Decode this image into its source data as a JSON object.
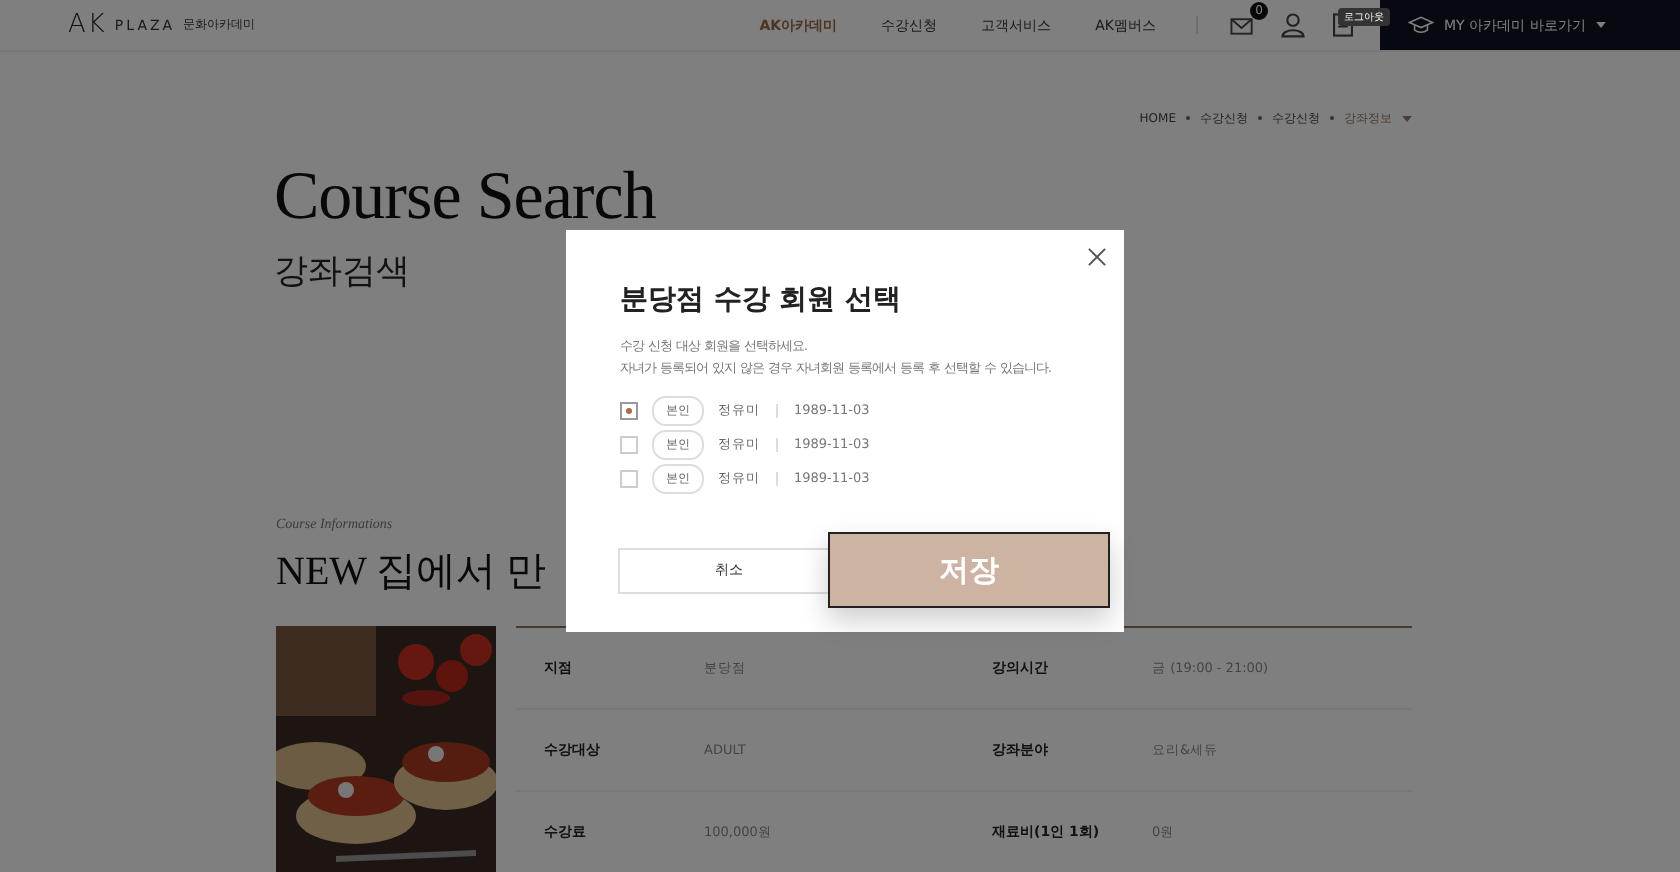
{
  "header": {
    "logo": {
      "mark": "AK",
      "brand": "PLAZA",
      "sub": "문화아카데미"
    },
    "nav": [
      {
        "label": "AK아카데미",
        "selected": true
      },
      {
        "label": "수강신청",
        "selected": false
      },
      {
        "label": "고객서비스",
        "selected": false
      },
      {
        "label": "AK멤버스",
        "selected": false
      }
    ],
    "mail_badge": "0",
    "tooltip": "로그아웃",
    "my_button": "MY 아카데미 바로가기"
  },
  "breadcrumb": [
    {
      "label": "HOME",
      "current": false
    },
    {
      "label": "수강신청",
      "current": false
    },
    {
      "label": "수강신청",
      "current": false
    },
    {
      "label": "강좌정보",
      "current": true
    }
  ],
  "hero": {
    "title": "Course Search",
    "subtitle": "강좌검색"
  },
  "course": {
    "eyebrow": "Course Informations",
    "title": "NEW 집에서 만",
    "rows": [
      {
        "label": "지점",
        "value": "분당점",
        "label2": "강의시간",
        "value2": "금 (19:00 - 21:00)"
      },
      {
        "label": "수강대상",
        "value": "ADULT",
        "label2": "강좌분야",
        "value2": "요리&세듀"
      },
      {
        "label": "수강료",
        "value": "100,000원",
        "label2": "재료비(1인 1회)",
        "value2": "0원"
      }
    ]
  },
  "modal": {
    "title": "분당점 수강 회원 선택",
    "description": [
      "수강 신청 대상 회원을 선택하세요.",
      "자녀가 등록되어 있지 않은 경우 자녀회원 등록에서 등록 후 선택할 수 있습니다."
    ],
    "members": [
      {
        "tag": "본인",
        "name": "정유미",
        "birth": "1989-11-03",
        "checked": true
      },
      {
        "tag": "본인",
        "name": "정유미",
        "birth": "1989-11-03",
        "checked": false
      },
      {
        "tag": "본인",
        "name": "정유미",
        "birth": "1989-11-03",
        "checked": false
      }
    ],
    "cancel": "취소",
    "save": "저장"
  }
}
